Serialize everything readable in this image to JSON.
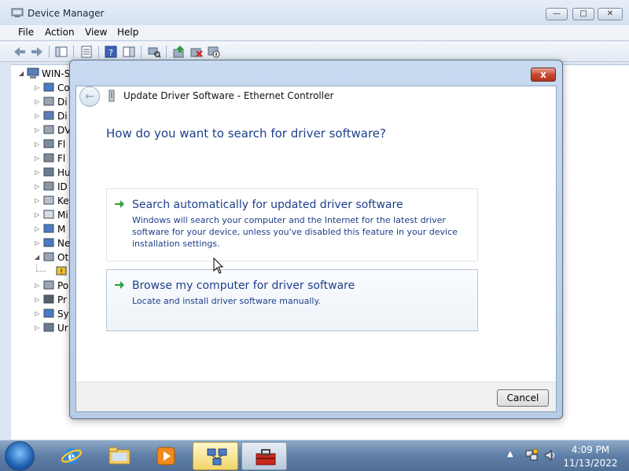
{
  "device_manager": {
    "title": "Device Manager",
    "menu": [
      "File",
      "Action",
      "View",
      "Help"
    ],
    "toolbar_icons": [
      "back-icon",
      "forward-icon",
      "show-hide-tree-icon",
      "properties-icon",
      "help-icon",
      "action-pane-icon",
      "scan-hardware-icon",
      "update-driver-icon",
      "uninstall-icon",
      "disable-icon"
    ],
    "tree": {
      "root": "WIN-S",
      "items": [
        {
          "label": "Co",
          "icon": "computer-icon"
        },
        {
          "label": "Di",
          "icon": "disk-drive-icon"
        },
        {
          "label": "Di",
          "icon": "display-adapter-icon"
        },
        {
          "label": "DV",
          "icon": "dvd-drive-icon"
        },
        {
          "label": "Fl",
          "icon": "floppy-controller-icon"
        },
        {
          "label": "Fl",
          "icon": "floppy-drive-icon"
        },
        {
          "label": "Hu",
          "icon": "hid-icon"
        },
        {
          "label": "ID",
          "icon": "ide-controller-icon"
        },
        {
          "label": "Ke",
          "icon": "keyboard-icon"
        },
        {
          "label": "Mi",
          "icon": "mouse-icon"
        },
        {
          "label": "M",
          "icon": "monitor-icon"
        },
        {
          "label": "Ne",
          "icon": "network-adapter-icon"
        },
        {
          "label": "Ot",
          "icon": "other-devices-icon"
        },
        {
          "label": "",
          "icon": "warning-device-icon"
        },
        {
          "label": "Po",
          "icon": "ports-icon"
        },
        {
          "label": "Pr",
          "icon": "processor-icon"
        },
        {
          "label": "Sy",
          "icon": "system-devices-icon"
        },
        {
          "label": "Ur",
          "icon": "usb-controller-icon"
        }
      ]
    }
  },
  "dialog": {
    "title": "Update Driver Software - Ethernet Controller",
    "question": "How do you want to search for driver software?",
    "options": [
      {
        "title": "Search automatically for updated driver software",
        "description": "Windows will search your computer and the Internet for the latest driver software for your device, unless you've disabled this feature in your device installation settings."
      },
      {
        "title": "Browse my computer for driver software",
        "description": "Locate and install driver software manually."
      }
    ],
    "cancel_label": "Cancel",
    "close_label": "x",
    "back_label": "←"
  },
  "taskbar": {
    "apps": [
      "start-orb-icon",
      "internet-explorer-icon",
      "windows-explorer-icon",
      "media-player-icon",
      "device-manager-icon",
      "toolbox-icon"
    ],
    "time": "4:09 PM",
    "date": "11/13/2022"
  },
  "colors": {
    "accent_text": "#1e3f8a",
    "dialog_frame": "#b5cbe6",
    "close_red": "#c5432a"
  }
}
